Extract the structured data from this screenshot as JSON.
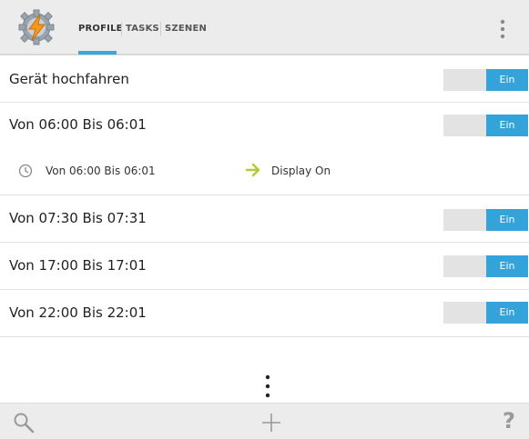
{
  "tabs": [
    {
      "label": "PROFILE",
      "active": true
    },
    {
      "label": "TASKS",
      "active": false
    },
    {
      "label": "SZENEN",
      "active": false
    }
  ],
  "profiles": [
    {
      "name": "Gerät hochfahren",
      "toggle": "Ein"
    },
    {
      "name": "Von 06:00 Bis 06:01",
      "toggle": "Ein"
    },
    {
      "name": "Von 07:30 Bis 07:31",
      "toggle": "Ein"
    },
    {
      "name": "Von 17:00 Bis 17:01",
      "toggle": "Ein"
    },
    {
      "name": "Von 22:00 Bis 22:01",
      "toggle": "Ein"
    }
  ],
  "expanded_profile": {
    "context": "Von 06:00 Bis 06:01",
    "task": "Display On"
  },
  "icons": {
    "app": "tasker-app-icon",
    "overflow": "overflow-menu-icon",
    "context": "clock-icon",
    "task_arrow": "arrow-right-icon",
    "search": "search-icon",
    "add": "add-icon",
    "help": "help-icon"
  },
  "bottombar": {
    "help_label": "?"
  },
  "colors": {
    "accent": "#33a3d9",
    "toolbar_bg": "#ececec",
    "arrow": "#b5c935"
  }
}
